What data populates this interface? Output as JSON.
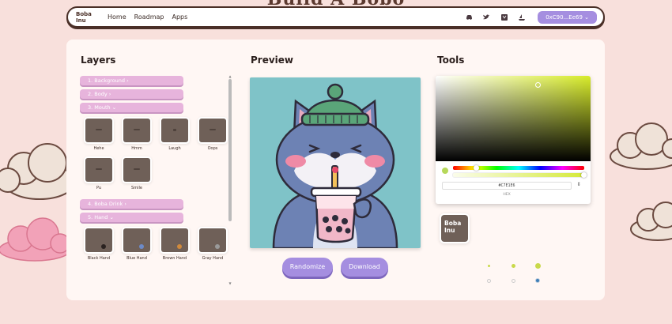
{
  "background_title": "Build A Bobo",
  "nav": {
    "logo_line1": "Boba",
    "logo_line2": "Inu",
    "links": [
      "Home",
      "Roadmap",
      "Apps"
    ],
    "icons": [
      "discord-icon",
      "twitter-icon",
      "medium-icon",
      "opensea-icon"
    ],
    "wallet_label": "0xC90...Ee69 ⌄"
  },
  "layers": {
    "title": "Layers",
    "categories": {
      "background": "1. Background ›",
      "body": "2. Body ›",
      "mouth": "3. Mouth ⌄",
      "drink": "4. Boba Drink ›",
      "hand": "5. Hand ⌄"
    },
    "mouth_options": [
      "Hehe",
      "Hmm",
      "Laugh",
      "Oops",
      "Pu",
      "Smile"
    ],
    "hand_options": [
      "Black Hand",
      "Blue Hand",
      "Brown Hand",
      "Gray Hand"
    ]
  },
  "preview": {
    "title": "Preview",
    "randomize_label": "Randomize",
    "download_label": "Download"
  },
  "tools": {
    "title": "Tools",
    "hex_value": "#C7E1E6",
    "hex_label": "HEX",
    "logo_line1": "Boba",
    "logo_line2": "Inu"
  },
  "colors": {
    "accent": "#a58ee0",
    "category": "#e7b4dc",
    "preview_bg": "#7fc3c8",
    "swatch": "#6f6058"
  }
}
